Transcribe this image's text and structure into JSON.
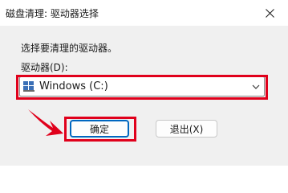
{
  "window": {
    "title": "磁盘清理: 驱动器选择"
  },
  "dialog": {
    "prompt": "选择要清理的驱动器。",
    "drive_label": "驱动器(D):",
    "selected_drive": "Windows (C:)",
    "ok_label": "确定",
    "exit_label": "退出(X)"
  },
  "icons": {
    "close": "close-icon",
    "drive": "drive-icon",
    "dropdown": "chevron-down-icon",
    "annotation": "arrow-icon"
  },
  "colors": {
    "highlight": "#e0001b",
    "accent": "#0067c0",
    "dialog_bg": "#f0f0f0"
  }
}
